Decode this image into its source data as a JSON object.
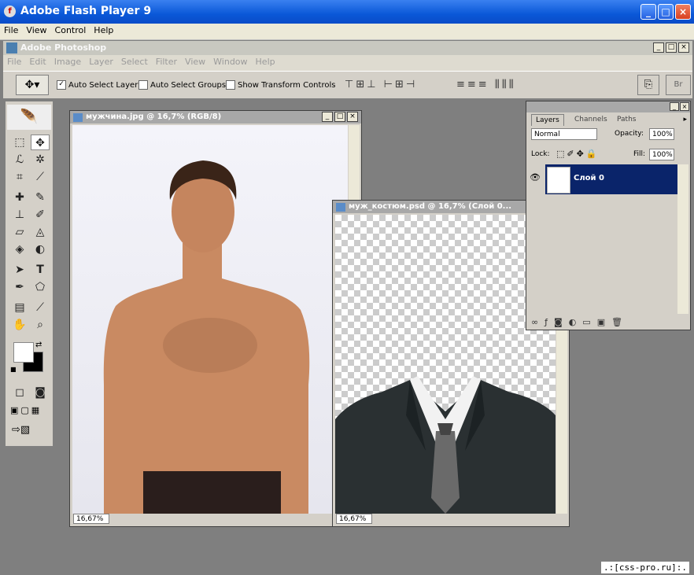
{
  "flash": {
    "title": "Adobe Flash Player 9",
    "menu": [
      "File",
      "View",
      "Control",
      "Help"
    ],
    "buttons": {
      "minimize": "_",
      "maximize": "□",
      "close": "×"
    }
  },
  "photoshop": {
    "title": "Adobe Photoshop",
    "menu": [
      "File",
      "Edit",
      "Image",
      "Layer",
      "Select",
      "Filter",
      "View",
      "Window",
      "Help"
    ],
    "options": {
      "auto_select_layer": "Auto Select Layer",
      "auto_select_groups": "Auto Select Groups",
      "show_transform_controls": "Show Transform Controls",
      "auto_select_layer_checked": true,
      "bridge_label": "Br"
    }
  },
  "doc1": {
    "title": "мужчина.jpg @ 16,7% (RGB/8)",
    "zoom": "16,67%"
  },
  "doc2": {
    "title": "муж_костюм.psd @ 16,7% (Слой 0...",
    "zoom": "16,67%"
  },
  "layers": {
    "tabs": [
      "Layers",
      "Channels",
      "Paths"
    ],
    "blend_mode": "Normal",
    "opacity_label": "Opacity:",
    "opacity": "100%",
    "lock_label": "Lock:",
    "fill_label": "Fill:",
    "fill": "100%",
    "layer_name": "Слой 0"
  },
  "watermark": ".:[css-pro.ru]:.",
  "colors": {
    "flash_title": "#0a58d8",
    "selected_layer": "#0a246a",
    "workspace": "#7f7f7f"
  }
}
